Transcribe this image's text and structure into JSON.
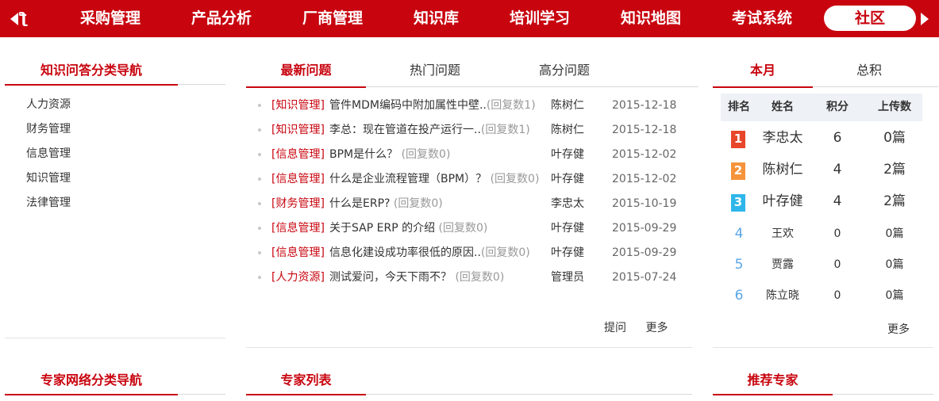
{
  "nav": {
    "partial_label": "ƪ",
    "items": [
      "采购管理",
      "产品分析",
      "厂商管理",
      "知识库",
      "培训学习",
      "知识地图",
      "考试系统"
    ],
    "active_label": "社区"
  },
  "qa_nav": {
    "title": "知识问答分类导航",
    "items": [
      "人力资源",
      "财务管理",
      "信息管理",
      "知识管理",
      "法律管理"
    ]
  },
  "questions": {
    "tabs": [
      "最新问题",
      "热门问题",
      "高分问题"
    ],
    "rows": [
      {
        "cat": "[知识管理]",
        "title": "管件MDM编码中附加属性中壁..",
        "reply": "(回复数1)",
        "user": "陈树仁",
        "date": "2015-12-18"
      },
      {
        "cat": "[知识管理]",
        "title": "李总：现在管道在投产运行一..",
        "reply": "(回复数1)",
        "user": "陈树仁",
        "date": "2015-12-18"
      },
      {
        "cat": "[信息管理]",
        "title": "BPM是什么？",
        "reply": "(回复数0)",
        "user": "叶存健",
        "date": "2015-12-02"
      },
      {
        "cat": "[信息管理]",
        "title": "什么是企业流程管理（BPM）？",
        "reply": "(回复数0)",
        "user": "叶存健",
        "date": "2015-12-02"
      },
      {
        "cat": "[财务管理]",
        "title": "什么是ERP?",
        "reply": "(回复数0)",
        "user": "李忠太",
        "date": "2015-10-19"
      },
      {
        "cat": "[信息管理]",
        "title": "关于SAP ERP 的介绍",
        "reply": "(回复数0)",
        "user": "叶存健",
        "date": "2015-09-29"
      },
      {
        "cat": "[信息管理]",
        "title": "信息化建设成功率很低的原因..",
        "reply": "(回复数0)",
        "user": "叶存健",
        "date": "2015-09-29"
      },
      {
        "cat": "[人力资源]",
        "title": "测试爱问，今天下雨不？",
        "reply": "(回复数0)",
        "user": "管理员",
        "date": "2015-07-24"
      }
    ],
    "ask_label": "提问",
    "more_label": "更多"
  },
  "ranking": {
    "tabs": [
      "本月",
      "总积"
    ],
    "headers": [
      "排名",
      "姓名",
      "积分",
      "上传数"
    ],
    "rows": [
      {
        "rank": "1",
        "name": "李忠太",
        "score": "6",
        "uploads": "0篇",
        "color": "#e8462b"
      },
      {
        "rank": "2",
        "name": "陈树仁",
        "score": "4",
        "uploads": "2篇",
        "color": "#f5943b"
      },
      {
        "rank": "3",
        "name": "叶存健",
        "score": "4",
        "uploads": "2篇",
        "color": "#2eb6ea"
      },
      {
        "rank": "4",
        "name": "王欢",
        "score": "0",
        "uploads": "0篇"
      },
      {
        "rank": "5",
        "name": "贾露",
        "score": "0",
        "uploads": "0篇"
      },
      {
        "rank": "6",
        "name": "陈立晓",
        "score": "0",
        "uploads": "0篇"
      }
    ],
    "more_label": "更多"
  },
  "bottom": {
    "expert_nav_title": "专家网络分类导航",
    "expert_list_title": "专家列表",
    "recommend_title": "推荐专家"
  },
  "colors": {
    "brand": "#c8050f",
    "reply": "#999999",
    "rank_num": "#5aa6e8"
  }
}
